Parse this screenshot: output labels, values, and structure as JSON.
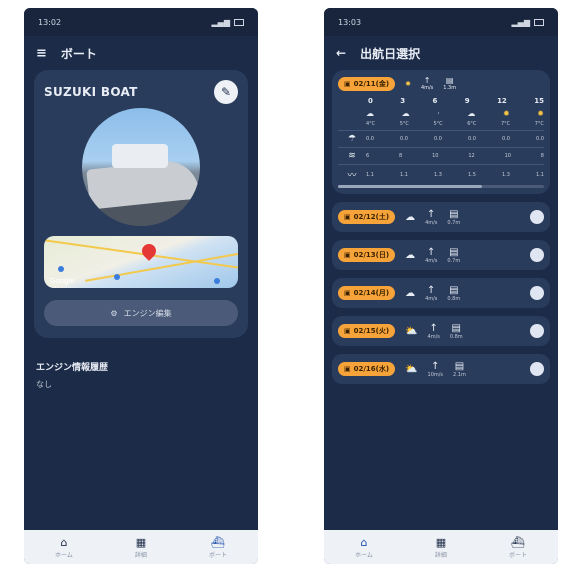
{
  "left": {
    "status_time": "13:02",
    "title": "ボート",
    "boat_name": "SUZUKI BOAT",
    "engine_button": "エンジン編集",
    "engine_history_title": "エンジン情報履歴",
    "engine_history_body": "なし",
    "nav": [
      {
        "label": "ホーム",
        "icon": "home-icon"
      },
      {
        "label": "詳細",
        "icon": "calendar-icon"
      },
      {
        "label": "ボート",
        "icon": "boat-icon"
      }
    ]
  },
  "right": {
    "status_time": "13:03",
    "title": "出航日選択",
    "hours": [
      "0",
      "3",
      "6",
      "9",
      "12",
      "15"
    ],
    "detail_date": "02/11(金)",
    "detail_summary": {
      "wind": "4m/s",
      "wave": "1.3m"
    },
    "temps": [
      "4°C",
      "5°C",
      "5°C",
      "6°C",
      "7°C",
      "7°C"
    ],
    "row_a": [
      "0.0",
      "0.0",
      "0.0",
      "0.0",
      "0.0",
      "0.0"
    ],
    "row_b": [
      "6",
      "8",
      "10",
      "12",
      "10",
      "8"
    ],
    "row_c": [
      "1.1",
      "1.1",
      "1.3",
      "1.5",
      "1.3",
      "1.1"
    ],
    "days": [
      {
        "date": "02/12(土)",
        "wind": "4m/s",
        "wave": "0.7m"
      },
      {
        "date": "02/13(日)",
        "wind": "4m/s",
        "wave": "0.7m"
      },
      {
        "date": "02/14(月)",
        "wind": "4m/s",
        "wave": "0.8m"
      },
      {
        "date": "02/15(火)",
        "wind": "4m/s",
        "wave": "0.8m"
      },
      {
        "date": "02/16(水)",
        "wind": "10m/s",
        "wave": "2.1m"
      }
    ],
    "nav": [
      {
        "label": "ホーム",
        "icon": "home-icon"
      },
      {
        "label": "詳細",
        "icon": "calendar-icon"
      },
      {
        "label": "ボート",
        "icon": "boat-icon"
      }
    ]
  },
  "colors": {
    "background": "#1c2b47",
    "card": "#2a3c5c",
    "accent": "#f6a33a",
    "nav_active": "#1c4ea8"
  }
}
